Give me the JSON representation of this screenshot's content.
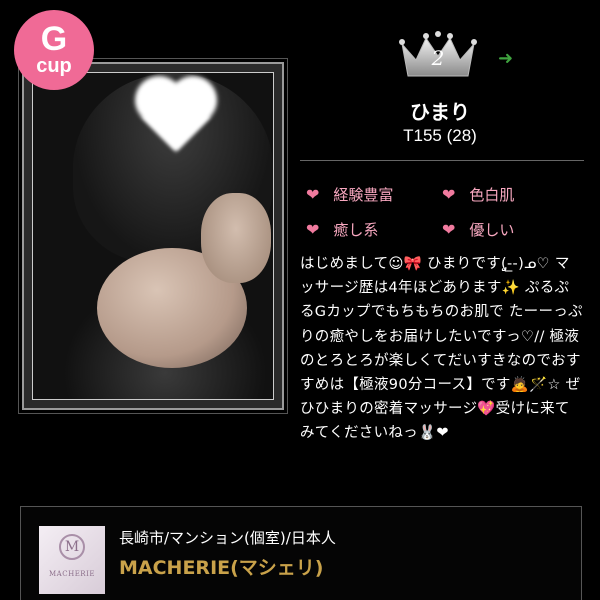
{
  "profile": {
    "cup_badge": {
      "letter": "G",
      "unit": "cup"
    },
    "rank": "2",
    "name": "ひまり",
    "stats": "T155 (28)",
    "tags": [
      "経験豊富",
      "色白肌",
      "癒し系",
      "優しい"
    ],
    "description": "はじめまして☺🎀 ひまりです(̨̡‑̲‑)ᓄ♡ マッサージ歴は4年ほどあります✨ ぷるぷるGカップでもちもちのお肌で たーーっぷりの癒やしをお届けしたいですっ♡// 極液のとろとろが楽しくてだいすきなのでおすすめは【極液90分コース】です🙇🪄☆ ぜひひまりの密着マッサージ💖受けに来てみてくださいねっ🐰❤"
  },
  "shop": {
    "area": "長崎市/マンション(個室)/日本人",
    "name": "MACHERIE(マシェリ)",
    "logo_label": "MACHERIE",
    "logo_initial": "M"
  },
  "colors": {
    "badge": "#f06a96",
    "tag_text": "#f7a7bf",
    "shop_name": "#c9a24a",
    "arrow": "#3fa33f"
  },
  "icons": {
    "tag": "heart-icon",
    "rank": "crown-icon",
    "trend": "arrow-right-icon"
  }
}
